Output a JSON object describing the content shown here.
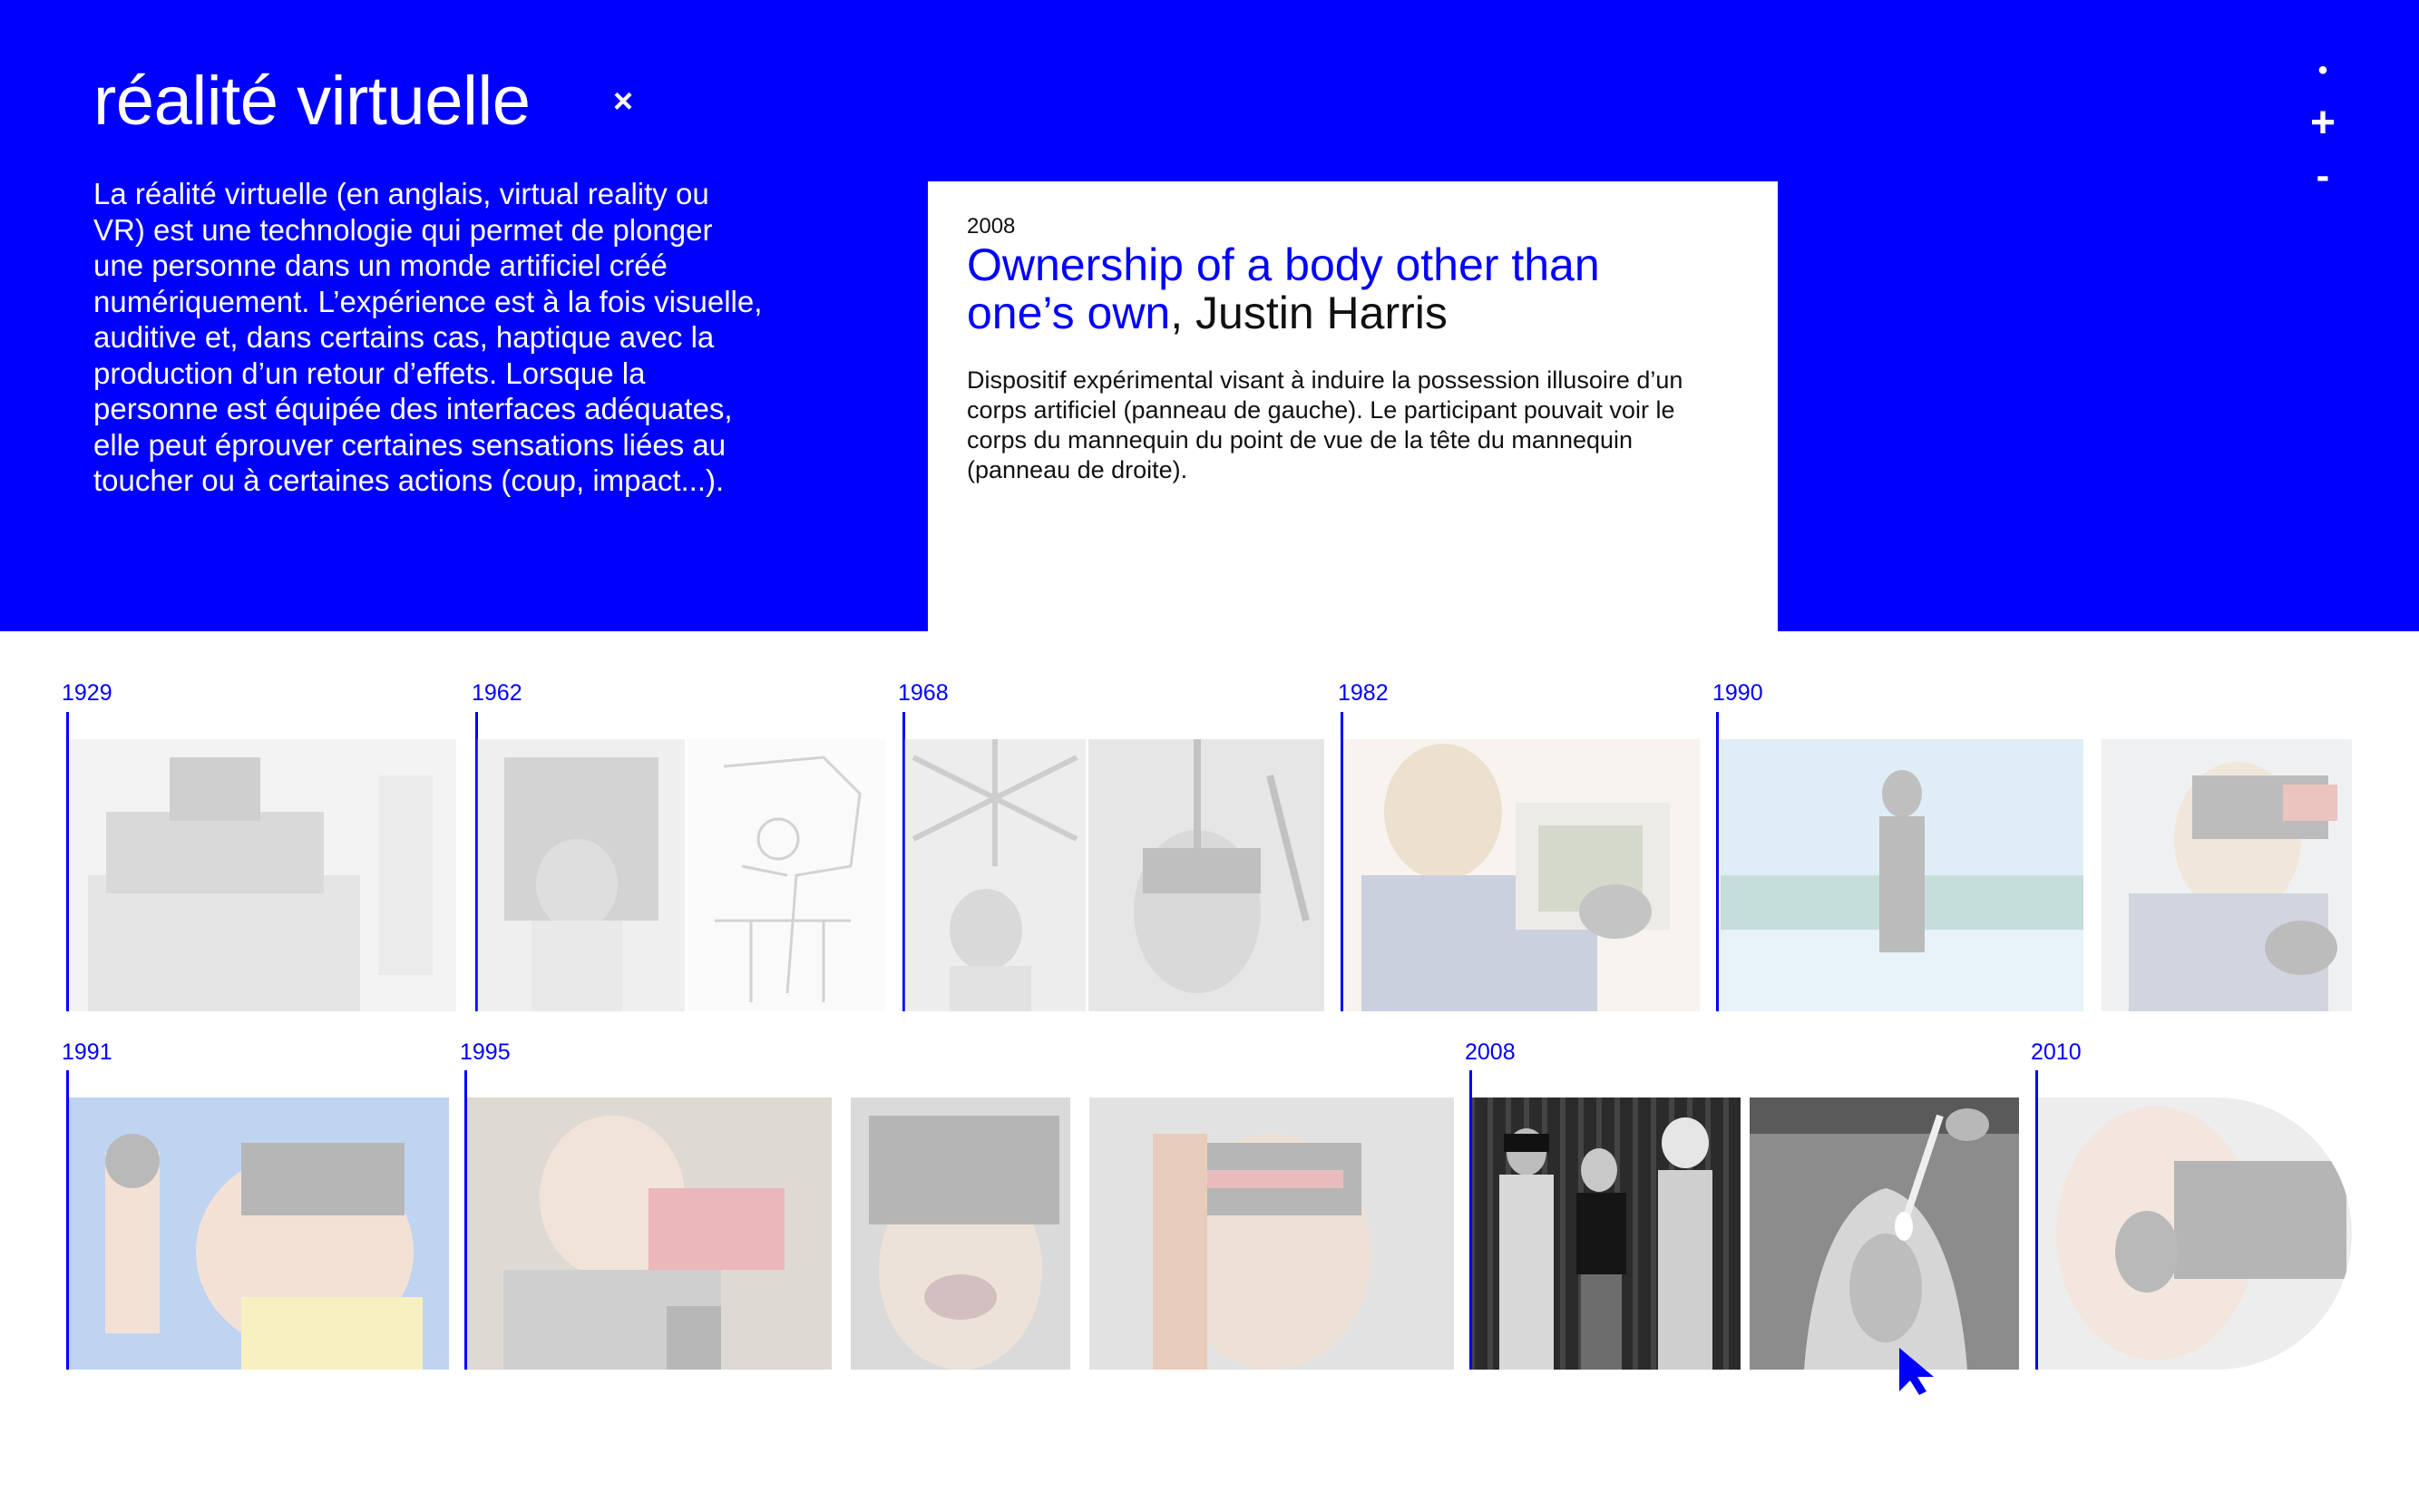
{
  "header": {
    "title": "réalité virtuelle",
    "close_symbol": "×",
    "intro": "La réalité virtuelle (en anglais, virtual reality ou VR) est une technologie qui permet de plonger une personne dans un monde artificiel créé numériquement. L’expérience est à la fois visuelle, auditive et, dans certains cas, haptique avec la production d’un retour d’effets. Lorsque la personne est équipée des interfaces adéquates, elle peut éprouver certaines sensations liées au toucher ou à certaines actions (coup, impact...).",
    "bg_color": "#0000ff"
  },
  "zoom": {
    "dot": "•",
    "plus": "+",
    "minus": "-"
  },
  "card": {
    "year": "2008",
    "title": "Ownership of a body other than one’s own",
    "separator": ", ",
    "author": "Justin Harris",
    "description": "Dispositif expérimental visant à induire la possession illusoire d’un corps artificiel (panneau de gauche). Le participant pouvait voir le corps du mannequin du point de vue de la tête du mannequin (panneau de droite)."
  },
  "timeline": {
    "row1_years": [
      "1929",
      "1962",
      "1968",
      "1982",
      "1990"
    ],
    "row2_years": [
      "1991",
      "1995",
      "2008",
      "2010"
    ],
    "selected_year": "2008",
    "accent_color": "#0000ff"
  },
  "icons": [
    "close-icon",
    "zoom-plus-icon",
    "zoom-minus-icon",
    "pointer-cursor-icon"
  ]
}
